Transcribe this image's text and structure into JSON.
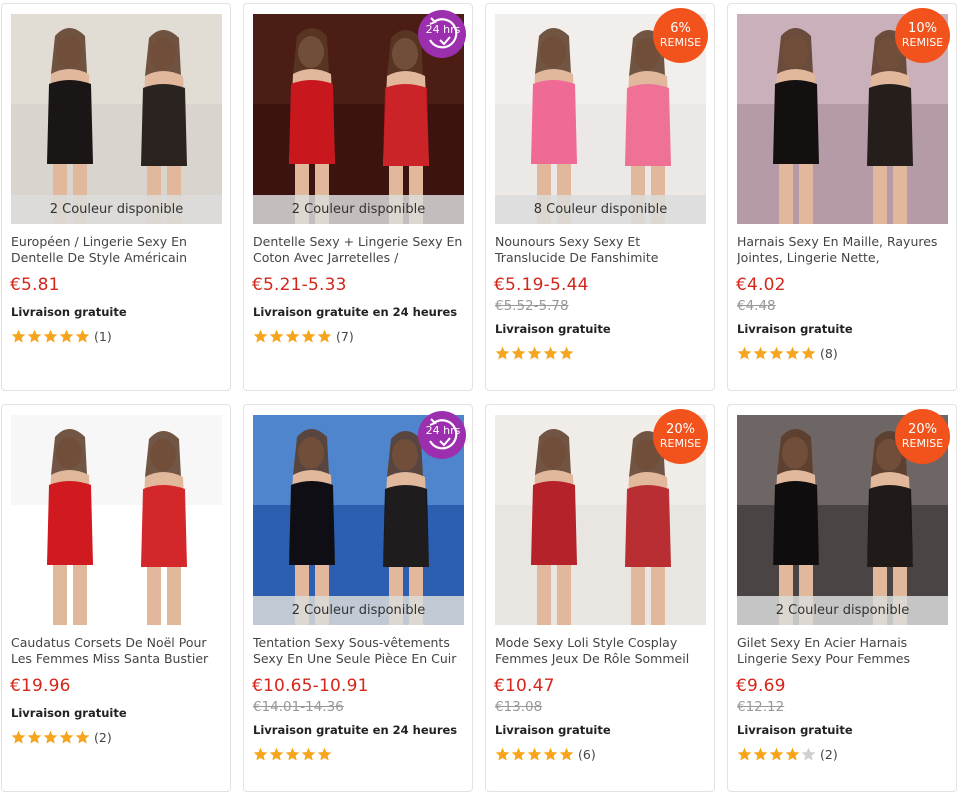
{
  "colors": {
    "price": "#d4261a",
    "discount_badge": "#f2521b",
    "badge_24h": "#9b2fae",
    "star_on": "#f7a51c",
    "star_off": "#d0d0d0"
  },
  "products": [
    {
      "title": "Européen / Lingerie Sexy En Dentelle De Style Américain",
      "price": "€5.81",
      "old_price": "",
      "shipping": "Livraison gratuite",
      "rating": 5,
      "reviews": "(1)",
      "colors_note": "2 Couleur disponible",
      "discount_pct": "",
      "discount_label": "",
      "badge_24": "",
      "image_palette": [
        "#d9d4cd",
        "#1a1616",
        "#e8e4dc"
      ]
    },
    {
      "title": "Dentelle Sexy + Lingerie Sexy En Coton Avec Jarretelles /",
      "price": "€5.21-5.33",
      "old_price": "",
      "shipping": "Livraison gratuite en 24 heures",
      "rating": 5,
      "reviews": "(7)",
      "colors_note": "2 Couleur disponible",
      "discount_pct": "",
      "discount_label": "",
      "badge_24": "24 hrs",
      "image_palette": [
        "#3b1410",
        "#c9171e",
        "#5a2418"
      ]
    },
    {
      "title": "Nounours Sexy Sexy Et Translucide De Fanshimite",
      "price": "€5.19-5.44",
      "old_price": "€5.52-5.78",
      "shipping": "Livraison gratuite",
      "rating": 5,
      "reviews": "",
      "colors_note": "8 Couleur disponible",
      "discount_pct": "6%",
      "discount_label": "REMISE",
      "badge_24": "",
      "image_palette": [
        "#ece8e6",
        "#f06a96",
        "#f6f3f1"
      ]
    },
    {
      "title": "Harnais Sexy En Maille, Rayures Jointes, Lingerie Nette,",
      "price": "€4.02",
      "old_price": "€4.48",
      "shipping": "Livraison gratuite",
      "rating": 5,
      "reviews": "(8)",
      "colors_note": "",
      "discount_pct": "10%",
      "discount_label": "REMISE",
      "badge_24": "",
      "image_palette": [
        "#b59aa8",
        "#151010",
        "#d8c3c8"
      ]
    },
    {
      "title": "Caudatus Corsets De Noël Pour Les Femmes Miss Santa Bustier",
      "price": "€19.96",
      "old_price": "",
      "shipping": "Livraison gratuite",
      "rating": 5,
      "reviews": "(2)",
      "colors_note": "",
      "discount_pct": "",
      "discount_label": "",
      "badge_24": "",
      "image_palette": [
        "#ffffff",
        "#d11a1f",
        "#f1f1f1"
      ]
    },
    {
      "title": "Tentation Sexy Sous-vêtements Sexy En Une Seule Pièce En Cuir",
      "price": "€10.65-10.91",
      "old_price": "€14.01-14.36",
      "shipping": "Livraison gratuite en 24 heures",
      "rating": 5,
      "reviews": "",
      "colors_note": "2 Couleur disponible",
      "discount_pct": "",
      "discount_label": "",
      "badge_24": "24 hrs",
      "image_palette": [
        "#2c5fb0",
        "#0e0e14",
        "#6da4e6"
      ]
    },
    {
      "title": "Mode Sexy Loli Style Cosplay Femmes Jeux De Rôle Sommeil",
      "price": "€10.47",
      "old_price": "€13.08",
      "shipping": "Livraison gratuite",
      "rating": 5,
      "reviews": "(6)",
      "colors_note": "",
      "discount_pct": "20%",
      "discount_label": "REMISE",
      "badge_24": "",
      "image_palette": [
        "#e9e5e0",
        "#b5222a",
        "#f5f2ee"
      ]
    },
    {
      "title": "Gilet Sexy En Acier Harnais Lingerie Sexy Pour Femmes",
      "price": "€9.69",
      "old_price": "€12.12",
      "shipping": "Livraison gratuite",
      "rating": 4,
      "reviews": "(2)",
      "colors_note": "2 Couleur disponible",
      "discount_pct": "20%",
      "discount_label": "REMISE",
      "badge_24": "",
      "image_palette": [
        "#4a4444",
        "#0f0d0d",
        "#8a8380"
      ]
    }
  ]
}
